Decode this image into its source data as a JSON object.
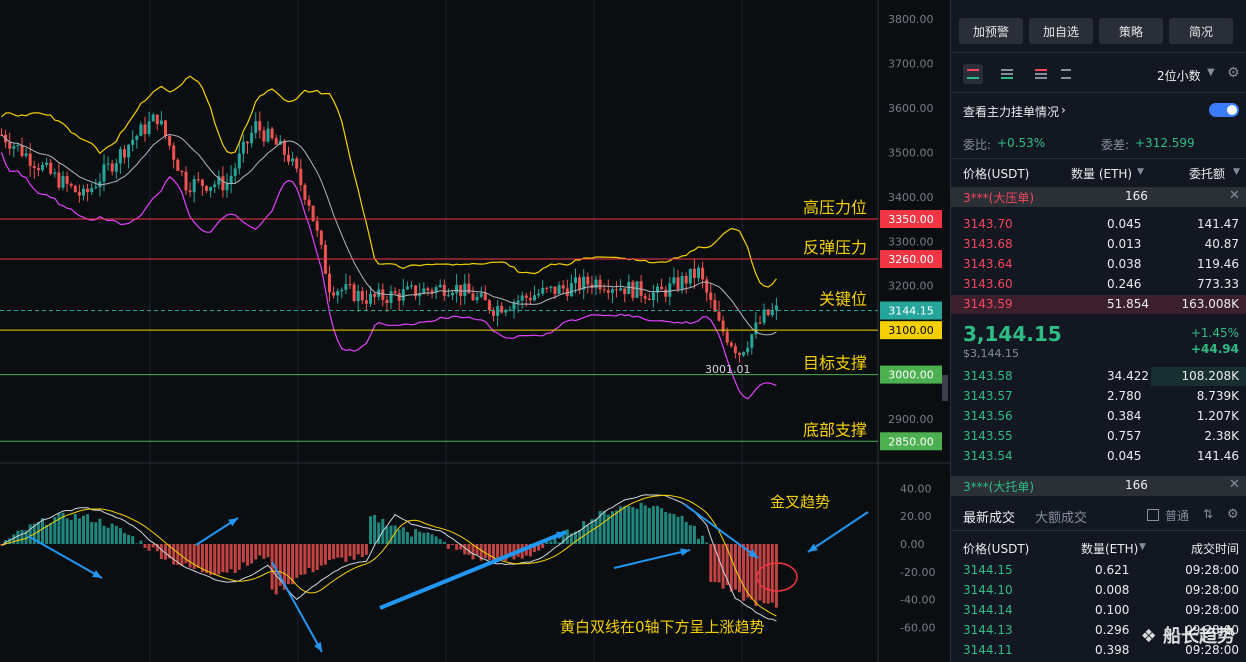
{
  "chart": {
    "price_ticks": [
      "3800.00",
      "3700.00",
      "3600.00",
      "3500.00",
      "3400.00",
      "3300.00",
      "3200.00",
      "3100.00",
      "3000.00",
      "2900.00"
    ],
    "macd_ticks": [
      "40.00",
      "20.00",
      "0.00",
      "-20.00",
      "-40.00",
      "-60.00"
    ],
    "levels": [
      {
        "price": 3350,
        "tag": "3350.00",
        "text": "高压力位",
        "color": "#f23645"
      },
      {
        "price": 3260,
        "tag": "3260.00",
        "text": "反弹压力",
        "color": "#f23645"
      },
      {
        "price": 3144.15,
        "tag": "3144.15",
        "text": "关键位",
        "color": "#26a69a"
      },
      {
        "price": 3100,
        "tag": "3100.00",
        "text": "",
        "color": "#f5d000"
      },
      {
        "price": 3000,
        "tag": "3000.00",
        "text": "目标支撑",
        "color": "#4caf50"
      },
      {
        "price": 2850,
        "tag": "2850.00",
        "text": "底部支撑",
        "color": "#4caf50"
      }
    ],
    "low_label": "3001.01",
    "annotation_golden_cross": "金叉趋势",
    "annotation_bottom": "黄白双线在0轴下方呈上涨趋势"
  },
  "panel": {
    "buttons": [
      "加预警",
      "加自选",
      "策略",
      "简况"
    ],
    "decimals": "2位小数",
    "depth_toggle_label": "查看主力挂单情况",
    "ratio_label": "委比:",
    "ratio_value": "+0.53%",
    "diff_label": "委差:",
    "diff_value": "+312.599",
    "col_price": "价格(USDT)",
    "col_qty": "数量 (ETH)",
    "col_amount": "委托额",
    "ask_banner": "3***(大压单)",
    "ask_banner_value": "166",
    "asks": [
      {
        "price": "3143.70",
        "qty": "0.045",
        "amt": "141.47"
      },
      {
        "price": "3143.68",
        "qty": "0.013",
        "amt": "40.87"
      },
      {
        "price": "3143.64",
        "qty": "0.038",
        "amt": "119.46"
      },
      {
        "price": "3143.60",
        "qty": "0.246",
        "amt": "773.33"
      },
      {
        "price": "3143.59",
        "qty": "51.854",
        "amt": "163.008K"
      }
    ],
    "last_price": "3,144.15",
    "last_price_usd": "$3,144.15",
    "change_pct": "+1.45%",
    "change_abs": "+44.94",
    "bids": [
      {
        "price": "3143.58",
        "qty": "34.422",
        "amt": "108.208K"
      },
      {
        "price": "3143.57",
        "qty": "2.780",
        "amt": "8.739K"
      },
      {
        "price": "3143.56",
        "qty": "0.384",
        "amt": "1.207K"
      },
      {
        "price": "3143.55",
        "qty": "0.757",
        "amt": "2.38K"
      },
      {
        "price": "3143.54",
        "qty": "0.045",
        "amt": "141.46"
      }
    ],
    "bid_banner": "3***(大托单)",
    "bid_banner_value": "166",
    "tab_latest": "最新成交",
    "tab_large": "大额成交",
    "normal_label": "普通",
    "trade_col_price": "价格(USDT)",
    "trade_col_qty": "数量(ETH)",
    "trade_col_time": "成交时间",
    "trades": [
      {
        "price": "3144.15",
        "qty": "0.621",
        "time": "09:28:00"
      },
      {
        "price": "3144.10",
        "qty": "0.008",
        "time": "09:28:00"
      },
      {
        "price": "3144.14",
        "qty": "0.100",
        "time": "09:28:00"
      },
      {
        "price": "3144.13",
        "qty": "0.296",
        "time": "09:28:00"
      },
      {
        "price": "3144.11",
        "qty": "0.398",
        "time": "09:28:00"
      }
    ],
    "watermark": "船长趋势"
  }
}
